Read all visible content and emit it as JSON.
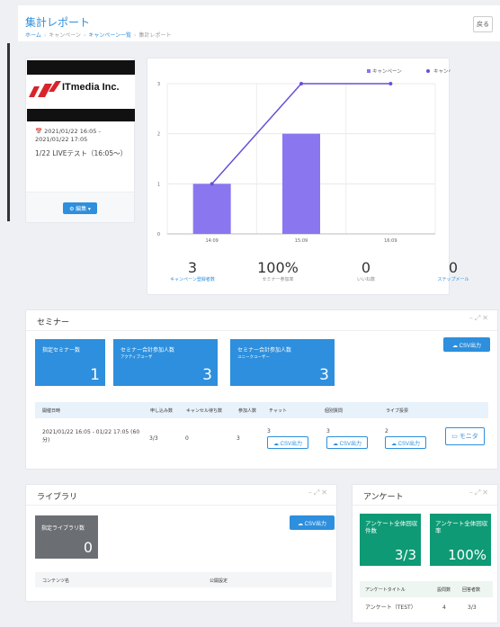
{
  "header": {
    "title": "集計レポート",
    "breadcrumb": [
      "ホーム",
      "キャンペーン",
      "キャンペーン一覧",
      "集計レポート"
    ],
    "back_label": "戻る"
  },
  "campaign": {
    "logo_text": "ITmedia Inc.",
    "date_range": "2021/01/22 16:05 - 2021/01/22 17:05",
    "name": "1/22 LIVEテスト（16:05〜）",
    "edit_label": "編集"
  },
  "chart_data": {
    "type": "bar+line",
    "categories": [
      "14:09",
      "15:09",
      "16:09"
    ],
    "series": [
      {
        "name": "キャンペーン",
        "kind": "bar",
        "values": [
          1,
          2,
          0
        ],
        "color": "#8a76ef"
      },
      {
        "name": "キャンペーン登録",
        "kind": "line",
        "values": [
          1,
          3,
          3
        ],
        "color": "#6a4fd6"
      }
    ],
    "ylim": [
      0,
      3
    ],
    "yticks": [
      0,
      1,
      2,
      3
    ],
    "grid": true,
    "legend": "top-right"
  },
  "stats": [
    {
      "value": "3",
      "label": "キャンペーン登録者数",
      "link": true
    },
    {
      "value": "100%",
      "label": "セミナー参加率",
      "link": false
    },
    {
      "value": "0",
      "label": "いいね数",
      "link": false
    },
    {
      "value": "0",
      "label": "ステップメール",
      "link": true
    }
  ],
  "seminar": {
    "title": "セミナー",
    "kpis": [
      {
        "label": "指定セミナー数",
        "sub": "",
        "value": "1"
      },
      {
        "label": "セミナー合計参加人数",
        "sub": "アクティブユーザ",
        "value": "3"
      },
      {
        "label": "セミナー合計参加人数",
        "sub": "ユニークユーザー",
        "value": "3"
      }
    ],
    "csv_label": "CSV出力",
    "columns": [
      "開催日時",
      "申し込み数",
      "キャンセル待ち数",
      "参加人数",
      "チャット",
      "個別質問",
      "ライブ投票"
    ],
    "row": {
      "datetime": "2021/01/22 16:05 - 01/22 17:05 (60分)",
      "applications": "3/3",
      "waitlist": "0",
      "participants": "3",
      "chat": "3",
      "questions": "3",
      "votes": "2",
      "csv_label": "CSV出力",
      "monitor_label": "モニタ"
    }
  },
  "library": {
    "title": "ライブラリ",
    "kpi_label": "指定ライブラリ数",
    "kpi_value": "0",
    "csv_label": "CSV出力",
    "columns": [
      "コンテンツ名",
      "公開設定"
    ]
  },
  "survey": {
    "title": "アンケート",
    "kpis": [
      {
        "label": "アンケート全体回収件数",
        "value": "3/3"
      },
      {
        "label": "アンケート全体回収率",
        "value": "100%"
      }
    ],
    "columns": [
      "アンケートタイトル",
      "設問数",
      "回答者数"
    ],
    "row": {
      "title": "アンケート（TEST）",
      "questions": "4",
      "respondents": "3/3"
    }
  },
  "icons": {
    "calendar": "calendar-icon",
    "gear": "gear-icon",
    "cloud": "cloud-download-icon",
    "monitor": "monitor-icon"
  },
  "colors": {
    "accent": "#2d8fdd",
    "bar": "#8a76ef",
    "line": "#6a4fd6",
    "green": "#0e9a75",
    "gray_kpi": "#6b6e73"
  }
}
